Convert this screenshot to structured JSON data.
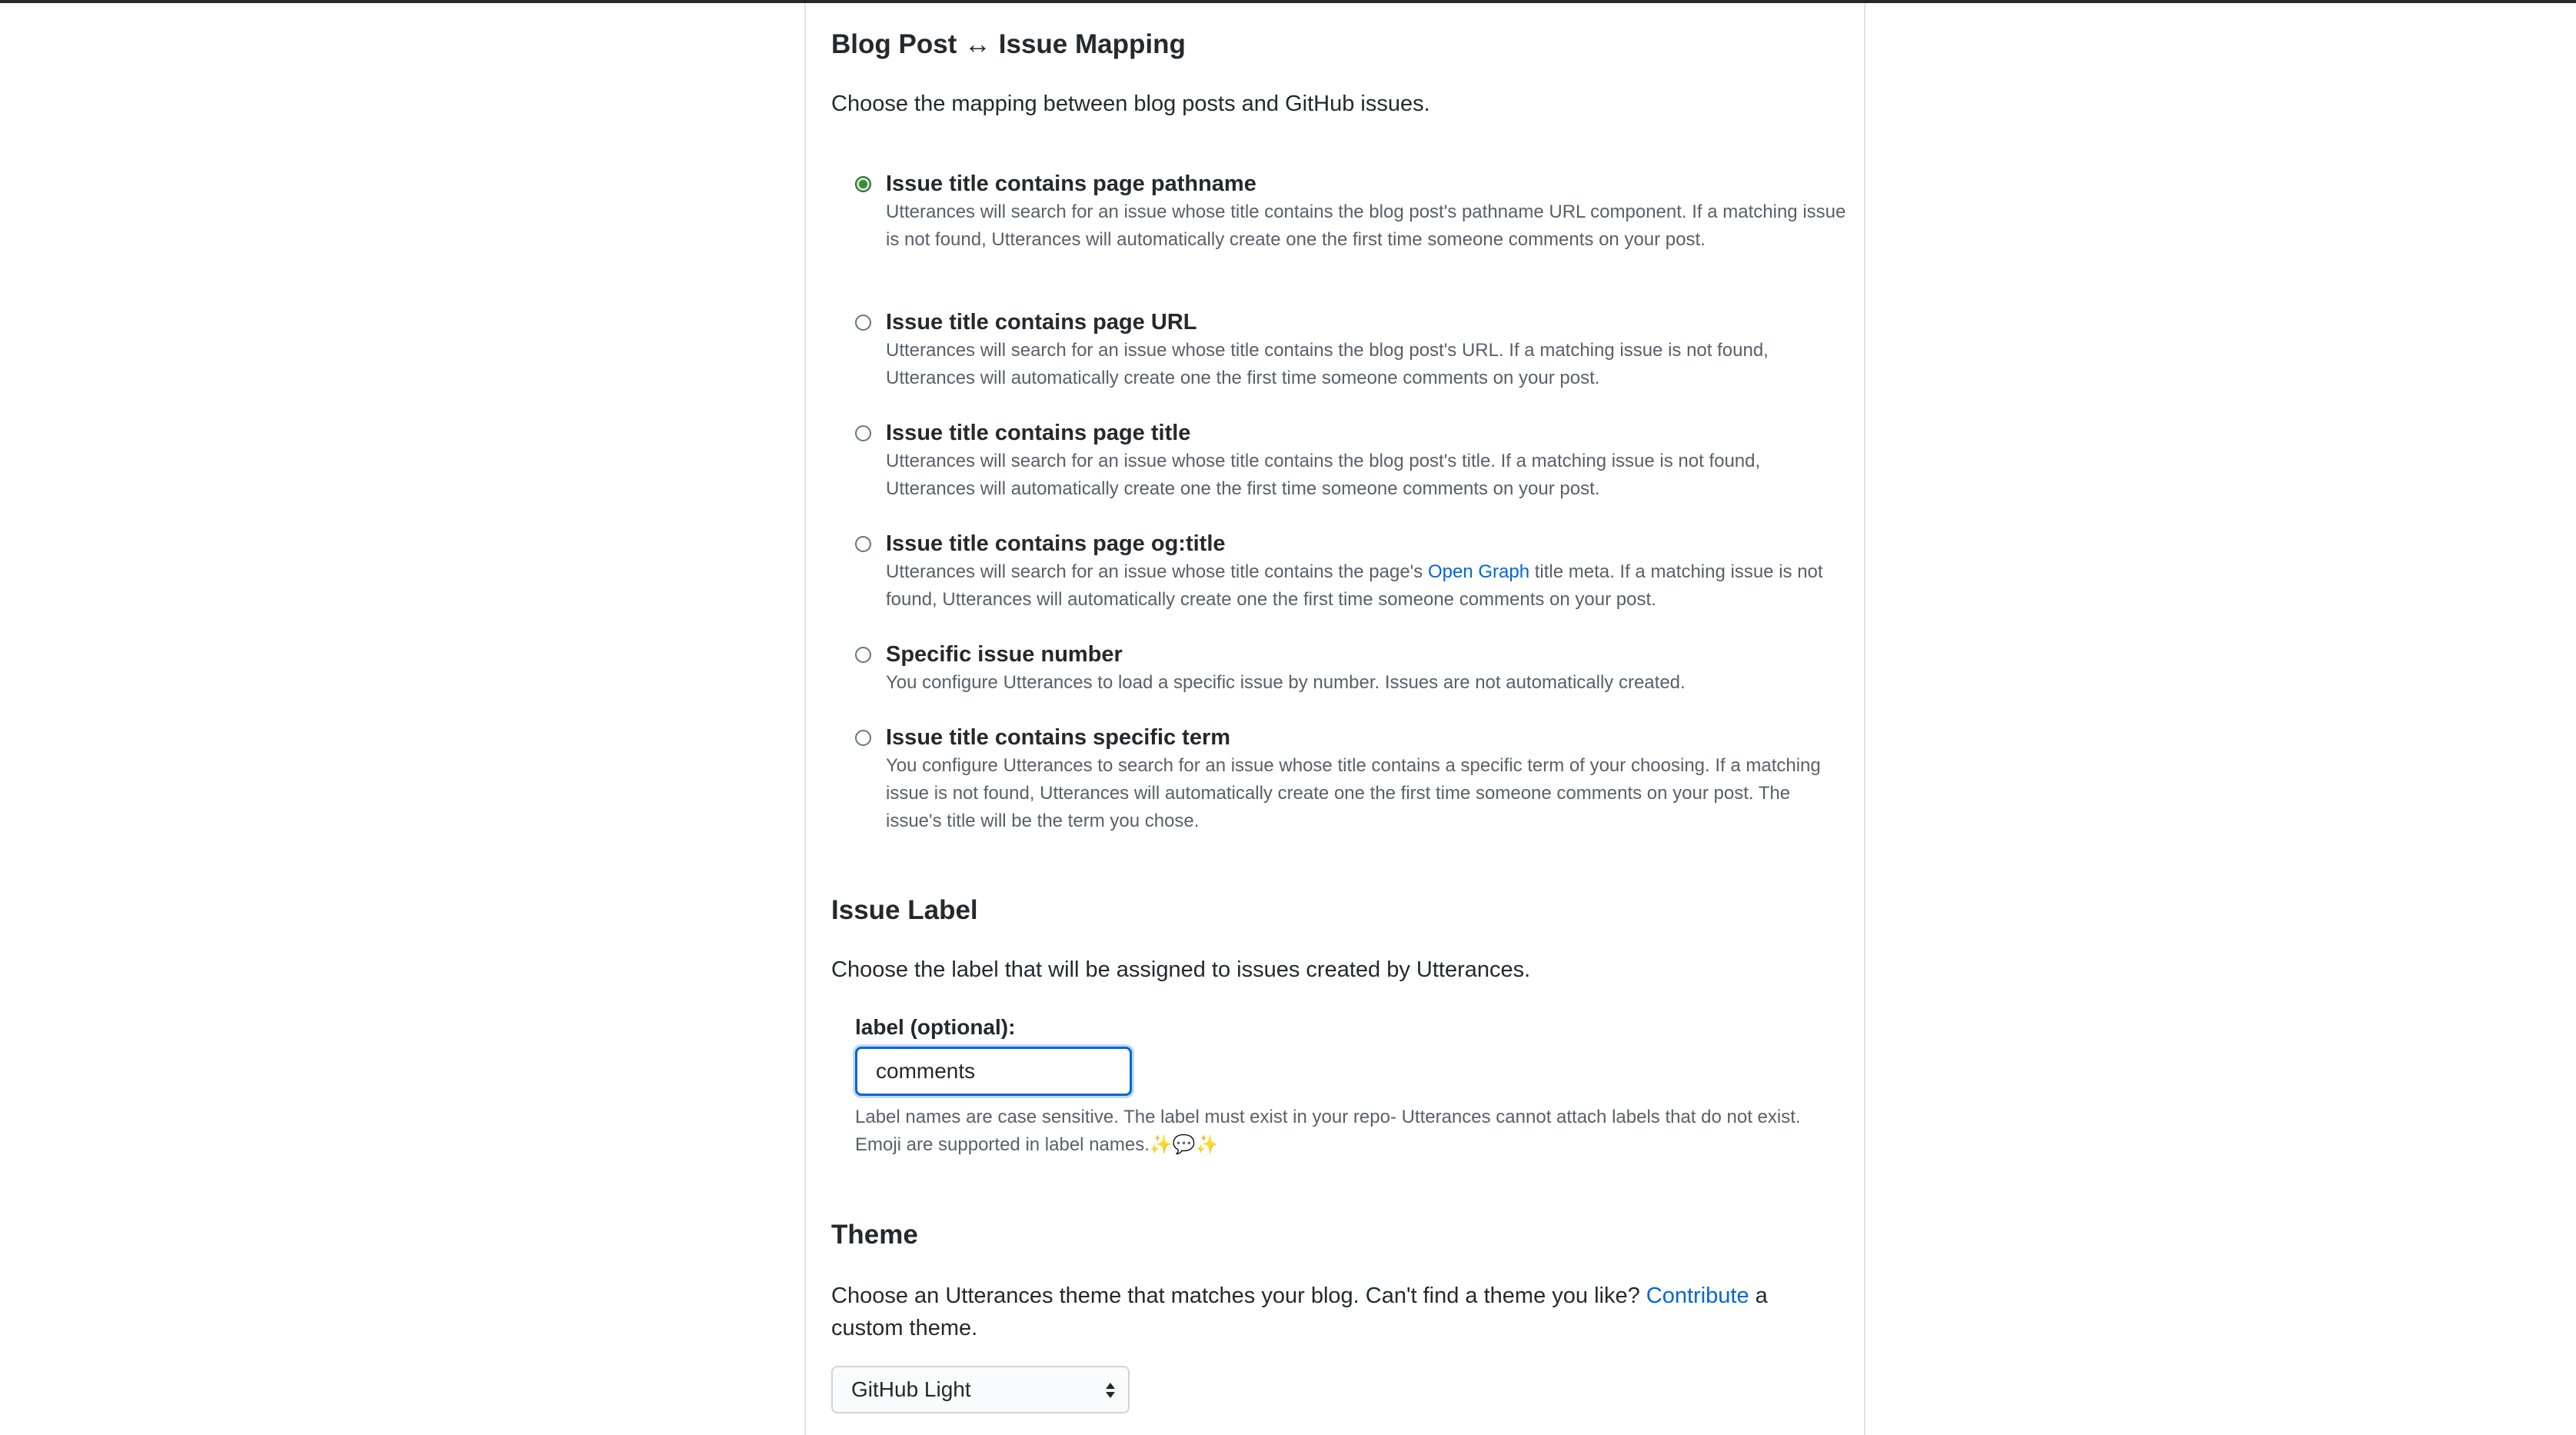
{
  "mapping": {
    "title": "Blog Post ↔ Issue Mapping",
    "description": "Choose the mapping between blog posts and GitHub issues.",
    "options": [
      {
        "label": "Issue title contains page pathname",
        "description": "Utterances will search for an issue whose title contains the blog post's pathname URL component. If a matching issue is not found, Utterances will automatically create one the first time someone comments on your post.",
        "checked": true
      },
      {
        "label": "Issue title contains page URL",
        "description": "Utterances will search for an issue whose title contains the blog post's URL. If a matching issue is not found, Utterances will automatically create one the first time someone comments on your post.",
        "checked": false
      },
      {
        "label": "Issue title contains page title",
        "description": "Utterances will search for an issue whose title contains the blog post's title. If a matching issue is not found, Utterances will automatically create one the first time someone comments on your post.",
        "checked": false
      },
      {
        "label": "Issue title contains page og:title",
        "description_before": "Utterances will search for an issue whose title contains the page's ",
        "description_link": "Open Graph",
        "description_after": " title meta. If a matching issue is not found, Utterances will automatically create one the first time someone comments on your post.",
        "checked": false
      },
      {
        "label": "Specific issue number",
        "description": "You configure Utterances to load a specific issue by number. Issues are not automatically created.",
        "checked": false
      },
      {
        "label": "Issue title contains specific term",
        "description": "You configure Utterances to search for an issue whose title contains a specific term of your choosing. If a matching issue is not found, Utterances will automatically create one the first time someone comments on your post. The issue's title will be the term you chose.",
        "checked": false
      }
    ]
  },
  "label_section": {
    "title": "Issue Label",
    "description": "Choose the label that will be assigned to issues created by Utterances.",
    "field_label": "label (optional):",
    "input_value": "comments",
    "note": "Label names are case sensitive. The label must exist in your repo- Utterances cannot attach labels that do not exist. Emoji are supported in label names.✨💬✨"
  },
  "theme_section": {
    "title": "Theme",
    "description_before": "Choose an Utterances theme that matches your blog. Can't find a theme you like? ",
    "description_link": "Contribute",
    "description_after": " a custom theme.",
    "selected_theme": "GitHub Light"
  },
  "colors": {
    "accent": "#0366d6",
    "text": "#24292e",
    "muted": "#586069",
    "radio_checked": "#3a8a3a"
  }
}
